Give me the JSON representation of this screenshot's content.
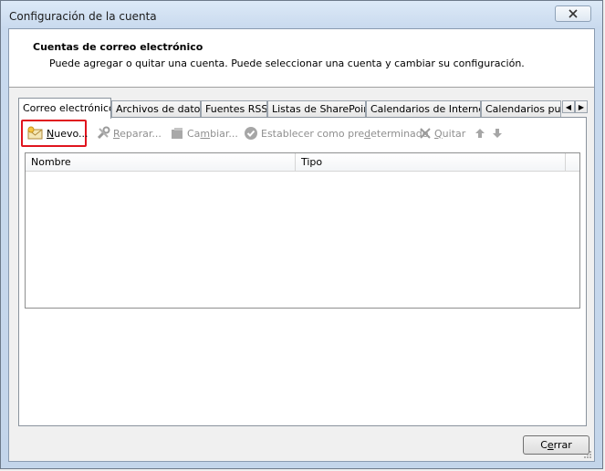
{
  "window": {
    "title": "Configuración de la cuenta"
  },
  "header": {
    "title": "Cuentas de correo electrónico",
    "subtitle": "Puede agregar o quitar una cuenta. Puede seleccionar una cuenta y cambiar su configuración."
  },
  "tabs": [
    {
      "label": "Correo electrónico",
      "active": true
    },
    {
      "label": "Archivos de datos",
      "active": false
    },
    {
      "label": "Fuentes RSS",
      "active": false
    },
    {
      "label": "Listas de SharePoint",
      "active": false
    },
    {
      "label": "Calendarios de Internet",
      "active": false
    },
    {
      "label": "Calendarios publi",
      "active": false
    }
  ],
  "toolbar": {
    "new_first": "N",
    "new_rest": "uevo...",
    "repair_first": "R",
    "repair_rest": "eparar...",
    "change_pre": "Ca",
    "change_mid": "m",
    "change_post": "biar...",
    "default_pre": "Establecer como pre",
    "default_mid": "d",
    "default_post": "eterminado",
    "remove_first": "Q",
    "remove_rest": "uitar"
  },
  "table": {
    "columns": [
      "Nombre",
      "Tipo"
    ],
    "rows": []
  },
  "footer": {
    "close_pre": "C",
    "close_mid": "e",
    "close_post": "rrar"
  },
  "colors": {
    "highlight": "#e0141e",
    "title_bar": "#c9daee"
  }
}
